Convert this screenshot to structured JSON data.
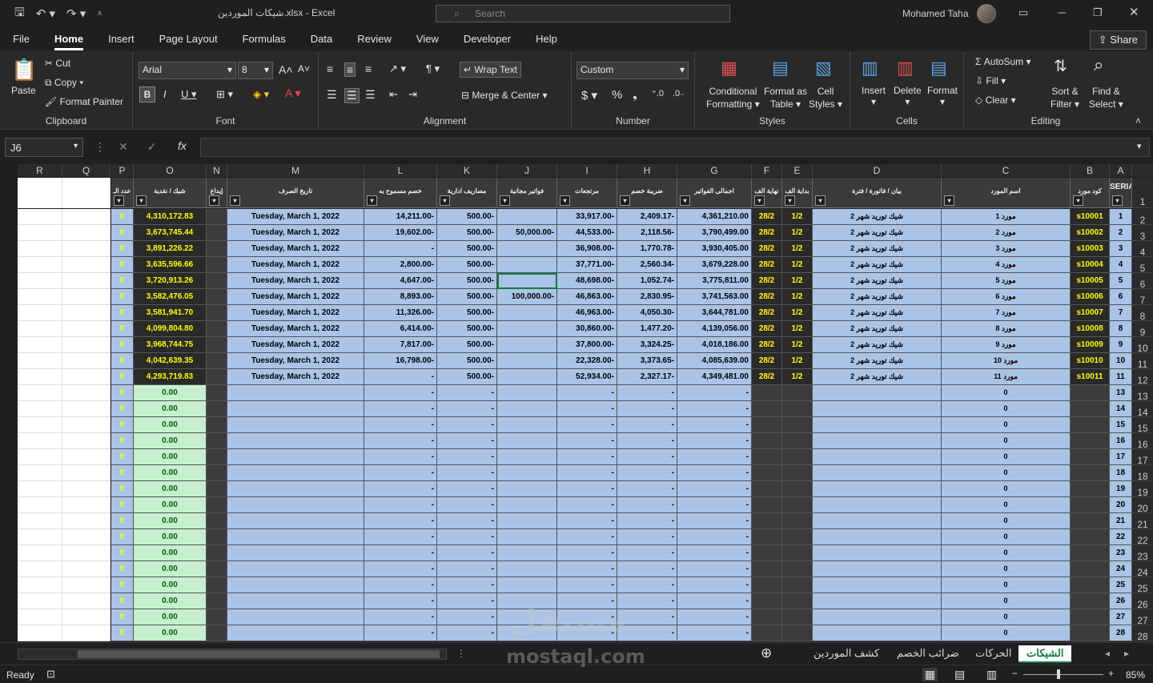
{
  "window": {
    "file_title": "شيكات الموردين.xlsx",
    "app": "Excel",
    "search_placeholder": "Search",
    "user": "Mohamed Taha",
    "share": "Share"
  },
  "menu": [
    "File",
    "Home",
    "Insert",
    "Page Layout",
    "Formulas",
    "Data",
    "Review",
    "View",
    "Developer",
    "Help"
  ],
  "ribbon": {
    "clipboard": {
      "label": "Clipboard",
      "paste": "Paste",
      "cut": "Cut",
      "copy": "Copy",
      "format_painter": "Format Painter"
    },
    "font": {
      "label": "Font",
      "family": "Arial",
      "size": "8"
    },
    "alignment": {
      "label": "Alignment",
      "wrap": "Wrap Text",
      "merge": "Merge & Center"
    },
    "number": {
      "label": "Number",
      "format": "Custom"
    },
    "styles": {
      "label": "Styles",
      "cond1": "Conditional",
      "cond2": "Formatting",
      "fat1": "Format as",
      "fat2": "Table",
      "cs1": "Cell",
      "cs2": "Styles"
    },
    "cells": {
      "label": "Cells",
      "insert": "Insert",
      "delete": "Delete",
      "format": "Format"
    },
    "editing": {
      "label": "Editing",
      "autosum": "AutoSum",
      "fill": "Fill",
      "clear": "Clear",
      "sort1": "Sort &",
      "sort2": "Filter",
      "find1": "Find &",
      "find2": "Select"
    }
  },
  "namebox": "J6",
  "columns": [
    "R",
    "Q",
    "P",
    "O",
    "N",
    "M",
    "L",
    "K",
    "J",
    "I",
    "H",
    "G",
    "F",
    "E",
    "D",
    "C",
    "B",
    "A"
  ],
  "headers": {
    "P": "عدد الـ",
    "O": "شيك / نقدية",
    "N": "إيداع",
    "M": "تاريخ الصرف",
    "L": "خصم مسموح به",
    "K": "مصاريف ادارية",
    "J": "فواتير مجانية",
    "I": "مرتجعات",
    "H": "ضريبة خصم",
    "G": "اجمالى الفواتير",
    "F": "نهاية الف",
    "E": "بداية الف",
    "D": "بيان / فاتورة / فترة",
    "C": "اسم المورد",
    "B": "كود مورد",
    "A": "SERIAL"
  },
  "date": "Tuesday, March 1, 2022",
  "desc": "شيك توريد شهر 2",
  "start": "1/2",
  "end": "28/2",
  "rows": [
    {
      "a": "1",
      "b": "s10001",
      "c": "مورد 1",
      "g": "4,361,210.00",
      "h": "2,409.17-",
      "i": "33,917.00-",
      "j": "",
      "k": "500.00-",
      "l": "14,211.00-",
      "o": "4,310,172.83"
    },
    {
      "a": "2",
      "b": "s10002",
      "c": "مورد 2",
      "g": "3,790,499.00",
      "h": "2,118.56-",
      "i": "44,533.00-",
      "j": "50,000.00-",
      "k": "500.00-",
      "l": "19,602.00-",
      "o": "3,673,745.44"
    },
    {
      "a": "3",
      "b": "s10003",
      "c": "مورد 3",
      "g": "3,930,405.00",
      "h": "1,770.78-",
      "i": "36,908.00-",
      "j": "",
      "k": "500.00-",
      "l": "-",
      "o": "3,891,226.22"
    },
    {
      "a": "4",
      "b": "s10004",
      "c": "مورد 4",
      "g": "3,679,228.00",
      "h": "2,560.34-",
      "i": "37,771.00-",
      "j": "",
      "k": "500.00-",
      "l": "2,800.00-",
      "o": "3,635,596.66"
    },
    {
      "a": "5",
      "b": "s10005",
      "c": "مورد 5",
      "g": "3,775,811.00",
      "h": "1,052.74-",
      "i": "48,698.00-",
      "j": "",
      "k": "500.00-",
      "l": "4,647.00-",
      "o": "3,720,913.26"
    },
    {
      "a": "6",
      "b": "s10006",
      "c": "مورد 6",
      "g": "3,741,563.00",
      "h": "2,830.95-",
      "i": "46,863.00-",
      "j": "100,000.00-",
      "k": "500.00-",
      "l": "8,893.00-",
      "o": "3,582,476.05"
    },
    {
      "a": "7",
      "b": "s10007",
      "c": "مورد 7",
      "g": "3,644,781.00",
      "h": "4,050.30-",
      "i": "46,963.00-",
      "j": "",
      "k": "500.00-",
      "l": "11,326.00-",
      "o": "3,581,941.70"
    },
    {
      "a": "8",
      "b": "s10008",
      "c": "مورد 8",
      "g": "4,139,056.00",
      "h": "1,477.20-",
      "i": "30,860.00-",
      "j": "",
      "k": "500.00-",
      "l": "6,414.00-",
      "o": "4,099,804.80"
    },
    {
      "a": "9",
      "b": "s10009",
      "c": "مورد 9",
      "g": "4,018,186.00",
      "h": "3,324.25-",
      "i": "37,800.00-",
      "j": "",
      "k": "500.00-",
      "l": "7,817.00-",
      "o": "3,968,744.75"
    },
    {
      "a": "10",
      "b": "s10010",
      "c": "مورد 10",
      "g": "4,085,639.00",
      "h": "3,373.65-",
      "i": "22,328.00-",
      "j": "",
      "k": "500.00-",
      "l": "16,798.00-",
      "o": "4,042,639.35"
    },
    {
      "a": "11",
      "b": "s10011",
      "c": "مورد 11",
      "g": "4,349,481.00",
      "h": "2,327.17-",
      "i": "52,934.00-",
      "j": "",
      "k": "500.00-",
      "l": "-",
      "o": "4,293,719.83"
    }
  ],
  "empty_serials": [
    "13",
    "14",
    "15",
    "16",
    "17",
    "18",
    "19",
    "20",
    "21",
    "22",
    "23",
    "24",
    "25",
    "26",
    "27",
    "28"
  ],
  "empty_zero": "0",
  "empty_money": "0.00",
  "dash": "-",
  "row_numbers": [
    "1",
    "2",
    "3",
    "4",
    "5",
    "6",
    "7",
    "8",
    "9",
    "10",
    "11",
    "12",
    "13",
    "14",
    "15",
    "16",
    "17",
    "18",
    "19",
    "20",
    "21",
    "22",
    "23",
    "24",
    "25",
    "26",
    "27",
    "28"
  ],
  "sheets": [
    "الشيكات",
    "الحركات",
    "ضرائب الخصم",
    "كشف الموردين"
  ],
  "status": {
    "ready": "Ready",
    "zoom": "85%"
  },
  "watermark": {
    "line1": "مستقل",
    "line2": "mostaql.com"
  }
}
